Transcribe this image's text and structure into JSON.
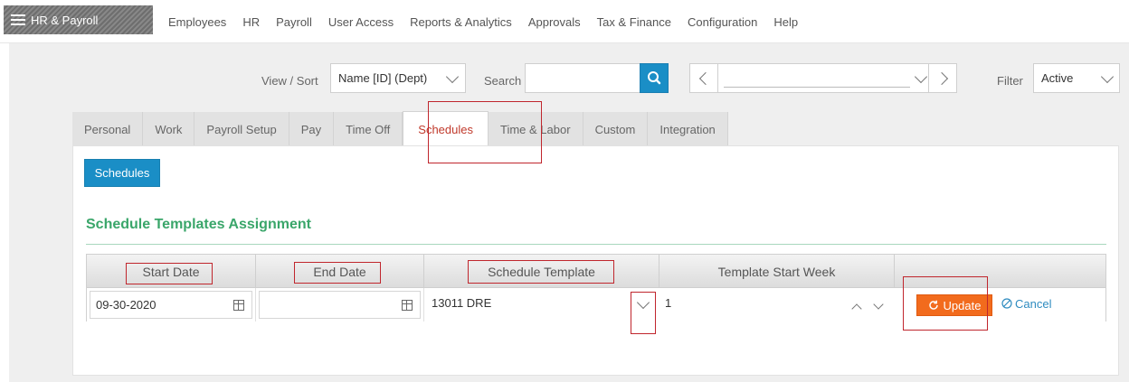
{
  "app": {
    "title": "HR & Payroll"
  },
  "nav": [
    "Employees",
    "HR",
    "Payroll",
    "User Access",
    "Reports & Analytics",
    "Approvals",
    "Tax & Finance",
    "Configuration",
    "Help"
  ],
  "toolbar": {
    "view_sort_label": "View / Sort",
    "view_sort_value": "Name [ID] (Dept)",
    "search_label": "Search",
    "search_value": "",
    "employee_select_value": "",
    "filter_label": "Filter",
    "filter_value": "Active"
  },
  "tabs": [
    "Personal",
    "Work",
    "Payroll Setup",
    "Pay",
    "Time Off",
    "Schedules",
    "Time & Labor",
    "Custom",
    "Integration"
  ],
  "active_tab": "Schedules",
  "panel": {
    "button_label": "Schedules",
    "section_title": "Schedule Templates Assignment"
  },
  "grid": {
    "columns": [
      "Start Date",
      "End Date",
      "Schedule Template",
      "Template Start Week",
      ""
    ],
    "row": {
      "start_date": "09-30-2020",
      "end_date": "",
      "schedule_template": "13011 DRE",
      "template_start_week": "1"
    },
    "update_label": "Update",
    "cancel_label": "Cancel"
  },
  "colors": {
    "accent": "#1a8ec6",
    "update": "#f26b1d",
    "section_title": "#3aa66a",
    "active_tab_text": "#c0392b",
    "annotation": "#c0262d"
  },
  "icons": {
    "menu": "hamburger-icon",
    "search": "search-icon",
    "calendar": "calendar-icon",
    "refresh": "refresh-icon",
    "cancel": "cancel-circle-icon"
  }
}
